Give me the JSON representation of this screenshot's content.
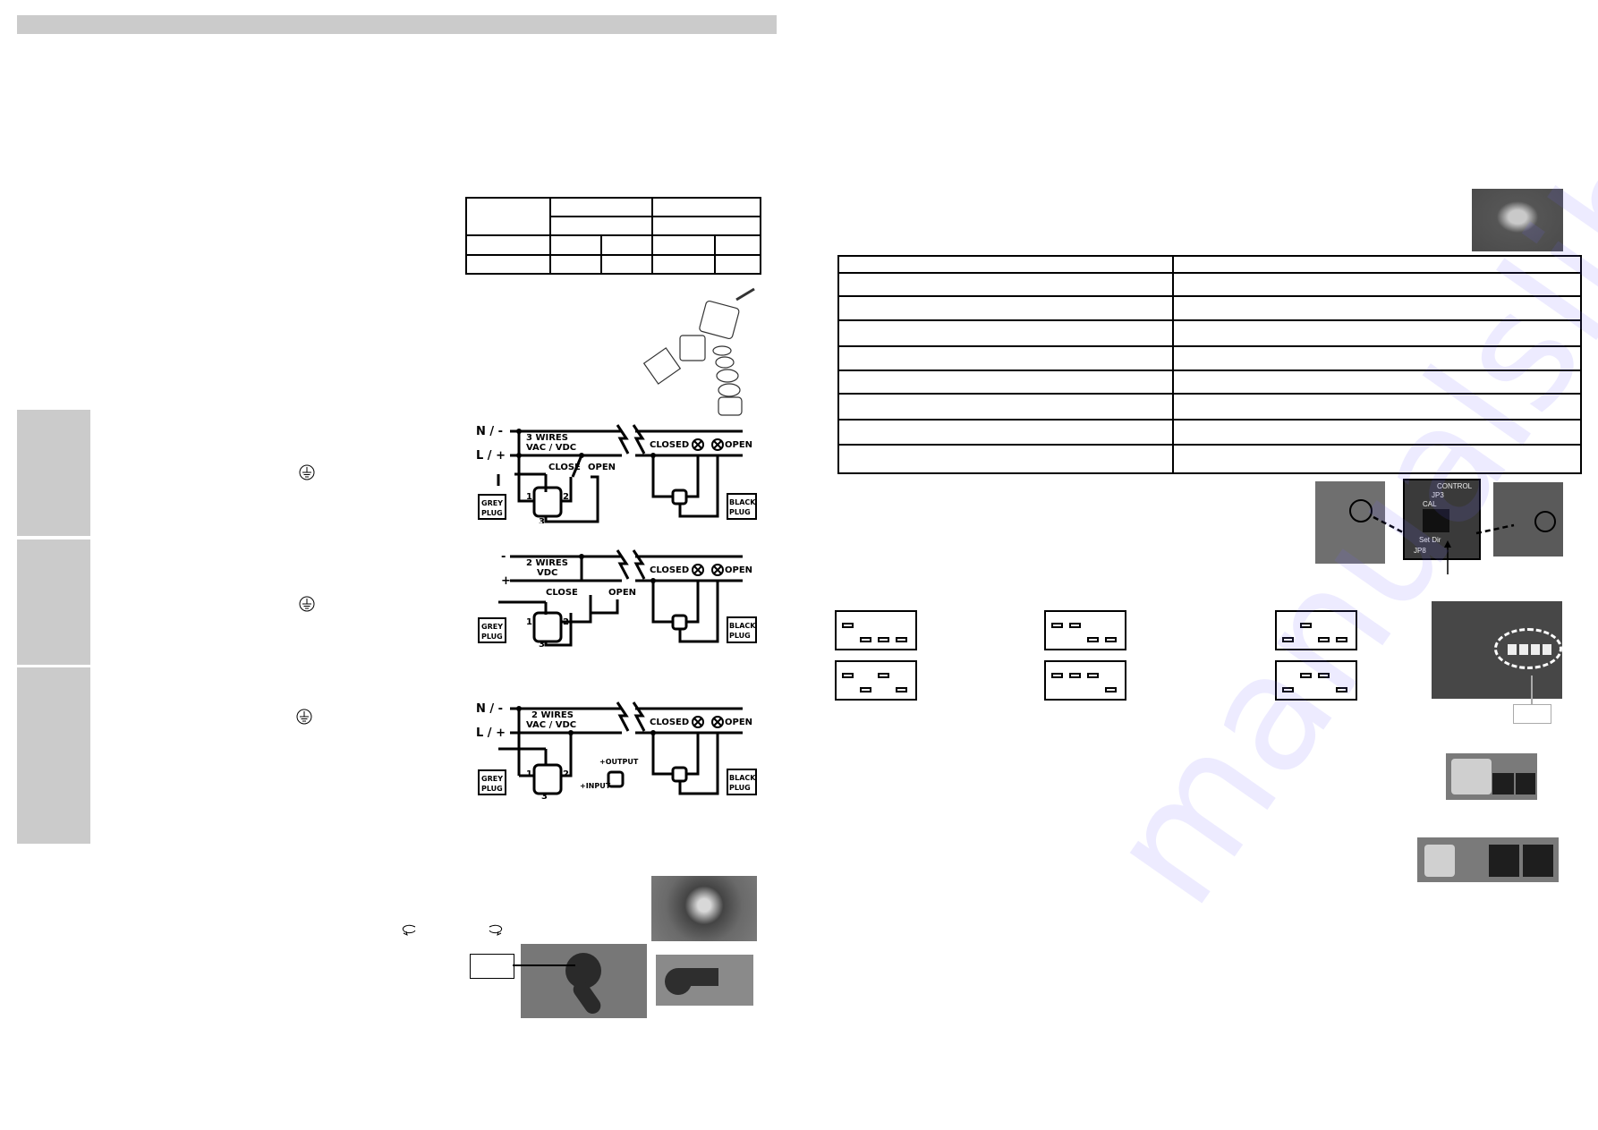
{
  "page": {
    "header_bar_text": "",
    "background": "#ffffff",
    "accent_grey": "#cbcbcb",
    "watermark": "manualslib.com"
  },
  "left_page": {
    "spec_table": {
      "rows": [
        [
          "",
          "",
          "",
          "",
          ""
        ],
        [
          "",
          "",
          "",
          "",
          ""
        ],
        [
          "",
          "",
          "",
          "",
          ""
        ],
        [
          "",
          "",
          "",
          "",
          ""
        ]
      ]
    },
    "side_tabs": [
      "",
      "",
      ""
    ],
    "ground_symbols": [
      "protective-earth-icon",
      "protective-earth-icon",
      "protective-earth-icon"
    ],
    "rotation_icons": [
      "rotate-counterclockwise-icon",
      "rotate-clockwise-icon"
    ],
    "diagrams": [
      {
        "supply_top": "N / -",
        "supply_bottom": "L / +",
        "wires_label_1": "3 WIRES",
        "wires_label_2": "VAC / VDC",
        "close": "CLOSE",
        "open": "OPEN",
        "closed_lamp": "CLOSED",
        "open_lamp": "OPEN",
        "grey_plug_1": "GREY",
        "grey_plug_2": "PLUG",
        "black_plug_1": "BLACK",
        "black_plug_2": "PLUG",
        "pin1": "1",
        "pin2": "2",
        "pin3": "3"
      },
      {
        "supply_top": "-",
        "supply_bottom": "+",
        "wires_label_1": "2 WIRES",
        "wires_label_2": "VDC",
        "close": "CLOSE",
        "open": "OPEN",
        "closed_lamp": "CLOSED",
        "open_lamp": "OPEN",
        "grey_plug_1": "GREY",
        "grey_plug_2": "PLUG",
        "black_plug_1": "BLACK",
        "black_plug_2": "PLUG",
        "pin1": "1",
        "pin2": "2",
        "pin3": "3"
      },
      {
        "supply_top": "N / -",
        "supply_bottom": "L / +",
        "wires_label_1": "2 WIRES",
        "wires_label_2": "VAC / VDC",
        "closed_lamp": "CLOSED",
        "open_lamp": "OPEN",
        "grey_plug_1": "GREY",
        "grey_plug_2": "PLUG",
        "black_plug_1": "BLACK",
        "black_plug_2": "PLUG",
        "relay_output": "+OUTPUT",
        "relay_input": "+INPUT",
        "pin1": "1",
        "pin2": "2",
        "pin3": "3"
      }
    ],
    "callout_label": ""
  },
  "right_page": {
    "settings_table": {
      "rows": [
        [
          "",
          ""
        ],
        [
          "",
          ""
        ],
        [
          "",
          ""
        ],
        [
          "",
          ""
        ],
        [
          "",
          ""
        ],
        [
          "",
          ""
        ],
        [
          "",
          ""
        ],
        [
          "",
          ""
        ],
        [
          "",
          ""
        ]
      ]
    },
    "pcb_photo_labels": {
      "control": "CONTROL",
      "jp3": "JP3",
      "cal": "CAL",
      "set_dir": "Set Dir",
      "jp8": "JP8"
    },
    "dip_switch_settings": [
      {
        "positions": [
          1,
          0,
          0,
          0
        ]
      },
      {
        "positions": [
          1,
          1,
          0,
          0
        ]
      },
      {
        "positions": [
          0,
          1,
          0,
          0
        ]
      },
      {
        "positions": [
          1,
          0,
          1,
          0
        ]
      },
      {
        "positions": [
          1,
          1,
          1,
          0
        ]
      },
      {
        "positions": [
          0,
          1,
          1,
          0
        ]
      }
    ],
    "dip_photo_callout": ""
  }
}
